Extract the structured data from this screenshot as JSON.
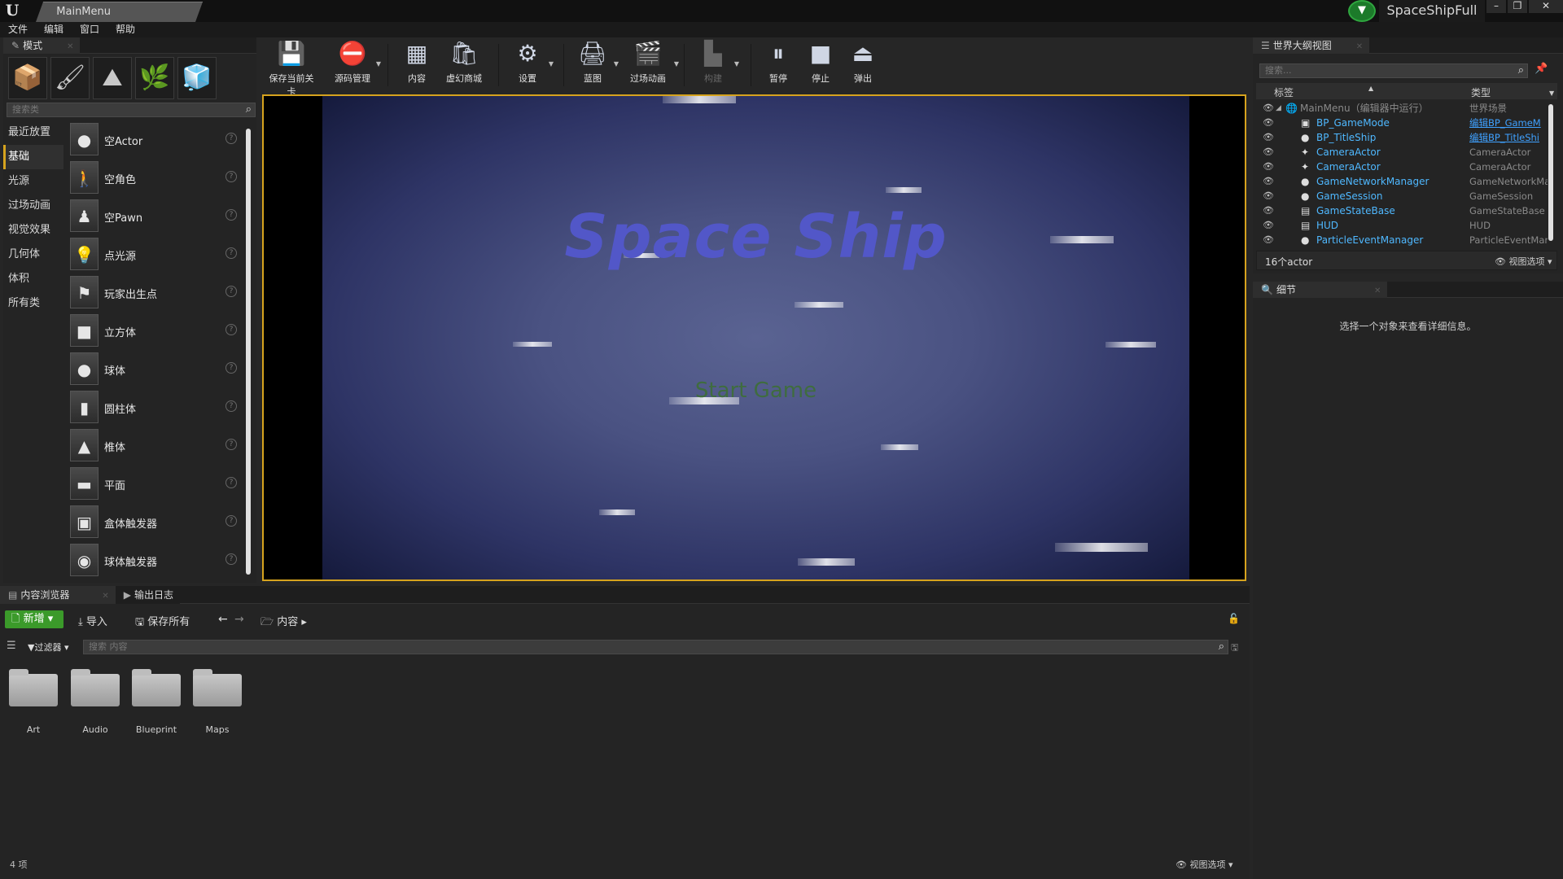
{
  "titlebar": {
    "logo": "U",
    "tab": "MainMenu",
    "project": "SpaceShipFull"
  },
  "menu": [
    "文件",
    "编辑",
    "窗口",
    "帮助"
  ],
  "modes": {
    "tab": "模式",
    "search_placeholder": "搜索类",
    "categories": [
      "最近放置",
      "基础",
      "光源",
      "过场动画",
      "视觉效果",
      "几何体",
      "体积",
      "所有类"
    ],
    "selected_category": "基础",
    "actors": [
      "空Actor",
      "空角色",
      "空Pawn",
      "点光源",
      "玩家出生点",
      "立方体",
      "球体",
      "圆柱体",
      "椎体",
      "平面",
      "盒体触发器",
      "球体触发器"
    ]
  },
  "toolbar": {
    "save": "保存当前关卡",
    "source": "源码管理",
    "content": "内容",
    "market": "虚幻商城",
    "settings": "设置",
    "blueprint": "蓝图",
    "cinematics": "过场动画",
    "build": "构建",
    "pause": "暂停",
    "stop": "停止",
    "eject": "弹出"
  },
  "viewport": {
    "title": "Space Ship",
    "start": "Start Game"
  },
  "outliner": {
    "tab": "世界大纲视图",
    "search_placeholder": "搜索...",
    "col_label": "标签",
    "col_type": "类型",
    "root_name": "MainMenu（编辑器中运行）",
    "root_type": "世界场景",
    "rows": [
      {
        "name": "BP_GameMode",
        "type": "编辑BP_GameM"
      },
      {
        "name": "BP_TitleShip",
        "type": "编辑BP_TitleShi"
      },
      {
        "name": "CameraActor",
        "type": "CameraActor"
      },
      {
        "name": "CameraActor",
        "type": "CameraActor"
      },
      {
        "name": "GameNetworkManager",
        "type": "GameNetworkMar"
      },
      {
        "name": "GameSession",
        "type": "GameSession"
      },
      {
        "name": "GameStateBase",
        "type": "GameStateBase"
      },
      {
        "name": "HUD",
        "type": "HUD"
      },
      {
        "name": "ParticleEventManager",
        "type": "ParticleEventMan"
      }
    ],
    "count": "16个actor",
    "view_options": "视图选项"
  },
  "details": {
    "tab": "细节",
    "hint": "选择一个对象来查看详细信息。"
  },
  "content_browser": {
    "tab": "内容浏览器",
    "tab2": "输出日志",
    "new": "新增",
    "import": "导入",
    "save_all": "保存所有",
    "path": "内容",
    "filters": "过滤器",
    "search_placeholder": "搜索 内容",
    "folders": [
      "Art",
      "Audio",
      "Blueprint",
      "Maps"
    ],
    "count": "4 项",
    "view_options": "视图选项"
  },
  "colors": {
    "accent": "#d6a31e",
    "link": "#4fb8ff",
    "new_button": "#3b9a2a"
  }
}
